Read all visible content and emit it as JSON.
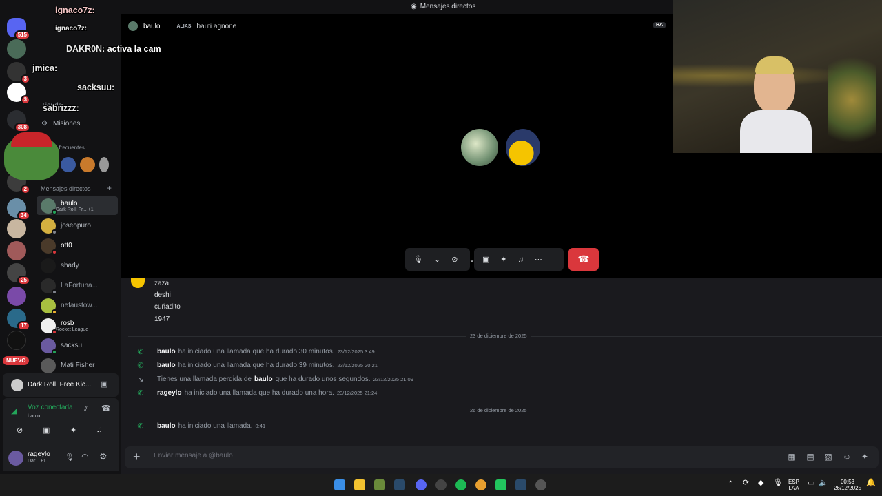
{
  "window": {
    "title": "Mensajes directos"
  },
  "rail": {
    "badges": [
      "515",
      "3",
      "3",
      "308",
      "2",
      "34",
      "25",
      "17"
    ],
    "nuevo_label": "NUEVO"
  },
  "sidebar": {
    "top_items": {
      "shop": "Tienda",
      "missions": "Misiones",
      "frequent": "ios frecuentes"
    },
    "dm_header": "Mensajes directos",
    "dms": [
      {
        "name": "baulo",
        "sub": "Dark Roll: Fr...  +1"
      },
      {
        "name": "joseopuro",
        "sub": ""
      },
      {
        "name": "ott0",
        "sub": ""
      },
      {
        "name": "shady",
        "sub": ""
      },
      {
        "name": "LaFortuna...",
        "sub": ""
      },
      {
        "name": "nefaustow...",
        "sub": ""
      },
      {
        "name": "rosb",
        "sub": "Rocket League"
      },
      {
        "name": "sacksu",
        "sub": ""
      },
      {
        "name": "Mati Fisher",
        "sub": ""
      }
    ]
  },
  "activity": {
    "label": "Dark Roll: Free Kic..."
  },
  "voice": {
    "status": "Voz conectada",
    "channel": "baulo"
  },
  "user": {
    "name": "rageylo",
    "sub": "Dar...  +1"
  },
  "call": {
    "header_name": "baulo",
    "alias_label": "ALIAS",
    "alias_value": "bauti agnone",
    "ha_label": "HA"
  },
  "chat": {
    "messages": [
      "zaza",
      "deshi",
      "cuñadito",
      "1947"
    ],
    "divider1": "23 de diciembre de 2025",
    "divider2": "26 de diciembre de 2025",
    "calls": [
      {
        "user": "baulo",
        "text": "ha iniciado una llamada que ha durado 30 minutos.",
        "ts": "23/12/2025 3:49",
        "missed": false
      },
      {
        "user": "baulo",
        "text": "ha iniciado una llamada que ha durado 39 minutos.",
        "ts": "23/12/2025 20:21",
        "missed": false
      },
      {
        "pre": "Tienes una llamada perdida de",
        "user": "baulo",
        "text": "que ha durado unos segundos.",
        "ts": "23/12/2025 21:09",
        "missed": true
      },
      {
        "user": "rageylo",
        "text": "ha iniciado una llamada que ha durado una hora.",
        "ts": "23/12/2025 21:24",
        "missed": false
      },
      {
        "user": "baulo",
        "text": "ha iniciado una llamada.",
        "ts": "0:41",
        "missed": false
      }
    ],
    "composer_placeholder": "Enviar mensaje a @baulo"
  },
  "stream_overlay": [
    {
      "user": "ignaco7z:",
      "text": ""
    },
    {
      "user": "ignaco7z:",
      "text": ""
    },
    {
      "user": "DAKR0N:",
      "text": "activa la cam"
    },
    {
      "user": "jmica:",
      "text": ""
    },
    {
      "user": "sacksuu:",
      "text": ""
    },
    {
      "user": "sabrizzz:",
      "text": ""
    }
  ],
  "taskbar": {
    "lang1": "ESP",
    "lang2": "LAA",
    "time": "00:53",
    "date": "26/12/2025"
  }
}
